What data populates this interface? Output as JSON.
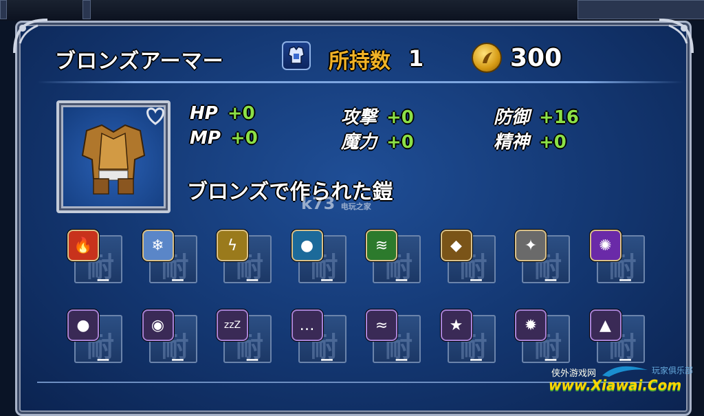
{
  "item": {
    "name": "ブロンズアーマー",
    "owned_label": "所持数",
    "owned_value": "1",
    "gil": "300",
    "description": "ブロンズで作られた鎧"
  },
  "stats": [
    {
      "label": "HP",
      "value": "+0"
    },
    {
      "label": "MP",
      "value": "+0"
    },
    {
      "label": "攻撃",
      "value": "+0"
    },
    {
      "label": "魔力",
      "value": "+0"
    },
    {
      "label": "防御",
      "value": "+16"
    },
    {
      "label": "精神",
      "value": "+0"
    }
  ],
  "resist_big_char": "耐",
  "elemental_resists": [
    {
      "icon": "fire-icon",
      "value": "ー",
      "color": "#c8321c"
    },
    {
      "icon": "ice-icon",
      "value": "ー",
      "color": "#5a86c8"
    },
    {
      "icon": "lightning-icon",
      "value": "ー",
      "color": "#9a7a1c"
    },
    {
      "icon": "water-icon",
      "value": "ー",
      "color": "#1c6a9a"
    },
    {
      "icon": "wind-icon",
      "value": "ー",
      "color": "#2c7a2c"
    },
    {
      "icon": "earth-icon",
      "value": "ー",
      "color": "#7a5418"
    },
    {
      "icon": "holy-icon",
      "value": "ー",
      "color": "#6a6a6a"
    },
    {
      "icon": "dark-icon",
      "value": "ー",
      "color": "#6a2aa8"
    }
  ],
  "status_resists": [
    {
      "icon": "poison-icon",
      "value": "ー",
      "color": "#3a2a56"
    },
    {
      "icon": "blind-icon",
      "value": "ー",
      "color": "#3a2a56"
    },
    {
      "icon": "sleep-icon",
      "value": "ー",
      "color": "#3a2a56",
      "glyph": "zzZ"
    },
    {
      "icon": "silence-icon",
      "value": "ー",
      "color": "#3a2a56"
    },
    {
      "icon": "paralyze-icon",
      "value": "ー",
      "color": "#3a2a56"
    },
    {
      "icon": "confuse-icon",
      "value": "ー",
      "color": "#3a2a56"
    },
    {
      "icon": "disease-icon",
      "value": "ー",
      "color": "#3a2a56"
    },
    {
      "icon": "petrify-icon",
      "value": "ー",
      "color": "#3a2a56"
    }
  ],
  "watermarks": {
    "k73": "k73",
    "k73_sub": "电玩之家",
    "site_cn_left": "侠外游戏网",
    "site_cn_right": "玩家俱乐部",
    "site_url": "www.Xiawai.Com"
  }
}
